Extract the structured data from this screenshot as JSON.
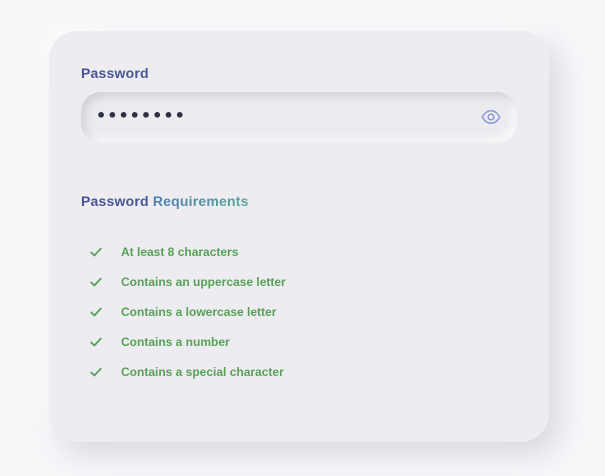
{
  "password_field": {
    "label": "Password",
    "value": "••••••••",
    "toggle_icon": "eye-icon"
  },
  "requirements": {
    "title_part1": "Password",
    "title_part2": "Requirements",
    "items": [
      {
        "label": "At least 8 characters",
        "met": true
      },
      {
        "label": "Contains an uppercase letter",
        "met": true
      },
      {
        "label": "Contains a lowercase letter",
        "met": true
      },
      {
        "label": "Contains a number",
        "met": true
      },
      {
        "label": "Contains a special character",
        "met": true
      }
    ]
  },
  "colors": {
    "label": "#4a5596",
    "success": "#57a157",
    "eye": "#8a98d6"
  }
}
